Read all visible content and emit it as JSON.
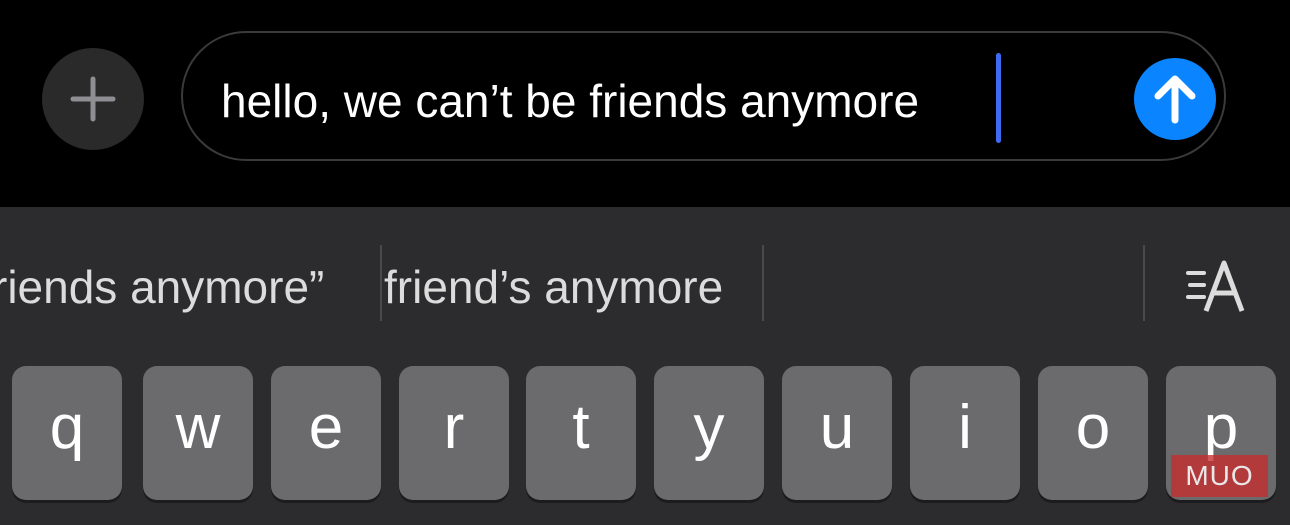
{
  "compose": {
    "message_text": "hello, we can’t be friends anymore",
    "plus_icon": "plus-icon",
    "send_icon": "arrow-up-icon",
    "send_color": "#0a84ff",
    "cursor_color": "#3e6bf2"
  },
  "keyboard": {
    "suggestions": [
      "riends anymore”",
      "friend’s anymore"
    ],
    "format_icon": "text-format-icon",
    "keys": [
      "q",
      "w",
      "e",
      "r",
      "t",
      "y",
      "u",
      "i",
      "o",
      "p"
    ]
  },
  "watermark": {
    "text": "MUO"
  }
}
